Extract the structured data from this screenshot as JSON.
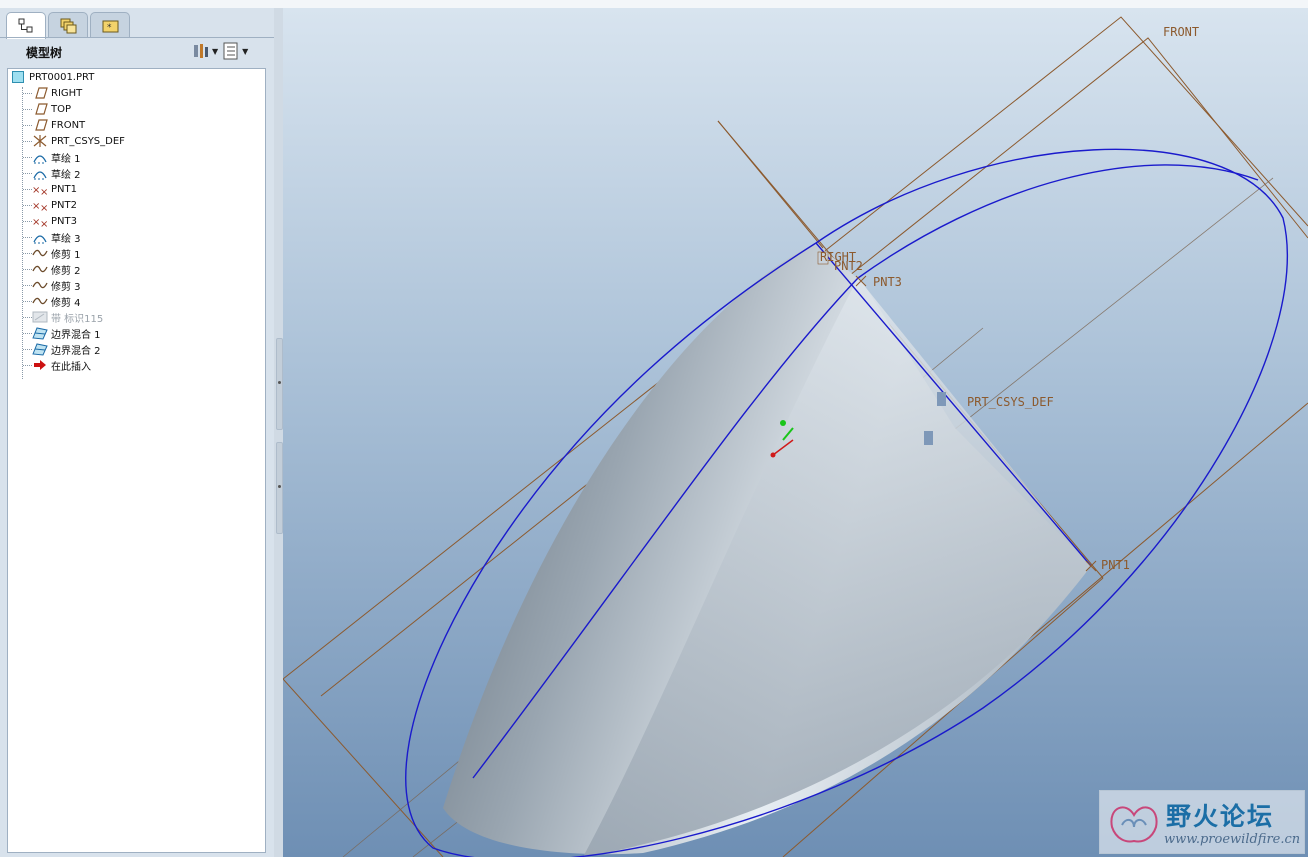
{
  "panel": {
    "title": "模型树",
    "tabs": [
      "model-tree-tab",
      "layers-tab",
      "favorites-tab"
    ]
  },
  "tree": {
    "root": "PRT0001.PRT",
    "items": [
      {
        "label": "RIGHT",
        "icon": "datum-plane-icon"
      },
      {
        "label": "TOP",
        "icon": "datum-plane-icon"
      },
      {
        "label": "FRONT",
        "icon": "datum-plane-icon"
      },
      {
        "label": "PRT_CSYS_DEF",
        "icon": "csys-icon"
      },
      {
        "label": "草绘 1",
        "icon": "sketch-icon"
      },
      {
        "label": "草绘 2",
        "icon": "sketch-icon"
      },
      {
        "label": "PNT1",
        "icon": "datum-point-icon"
      },
      {
        "label": "PNT2",
        "icon": "datum-point-icon"
      },
      {
        "label": "PNT3",
        "icon": "datum-point-icon"
      },
      {
        "label": "草绘 3",
        "icon": "sketch-icon"
      },
      {
        "label": "修剪 1",
        "icon": "trim-curve-icon"
      },
      {
        "label": "修剪 2",
        "icon": "trim-curve-icon"
      },
      {
        "label": "修剪 3",
        "icon": "trim-curve-icon"
      },
      {
        "label": "修剪 4",
        "icon": "trim-curve-icon"
      },
      {
        "label": "带 标识115",
        "icon": "band-icon"
      },
      {
        "label": "边界混合 1",
        "icon": "boundary-blend-icon"
      },
      {
        "label": "边界混合 2",
        "icon": "boundary-blend-icon"
      },
      {
        "label": "在此插入",
        "icon": "insert-here-arrow-icon"
      }
    ]
  },
  "viewport": {
    "labels": {
      "front": "FRONT",
      "right": "RIGHT",
      "pnt1": "PNT1",
      "pnt2": "PNT2",
      "pnt3": "PNT3",
      "csys": "PRT_CSYS_DEF"
    }
  },
  "watermark": {
    "title": "野火论坛",
    "url": "www.proewildfire.cn"
  },
  "colors": {
    "datum": "#8c5a2e",
    "curve": "#1a1acc",
    "viewport_top": "#d8e4ef",
    "viewport_bottom": "#6e8fb4"
  }
}
